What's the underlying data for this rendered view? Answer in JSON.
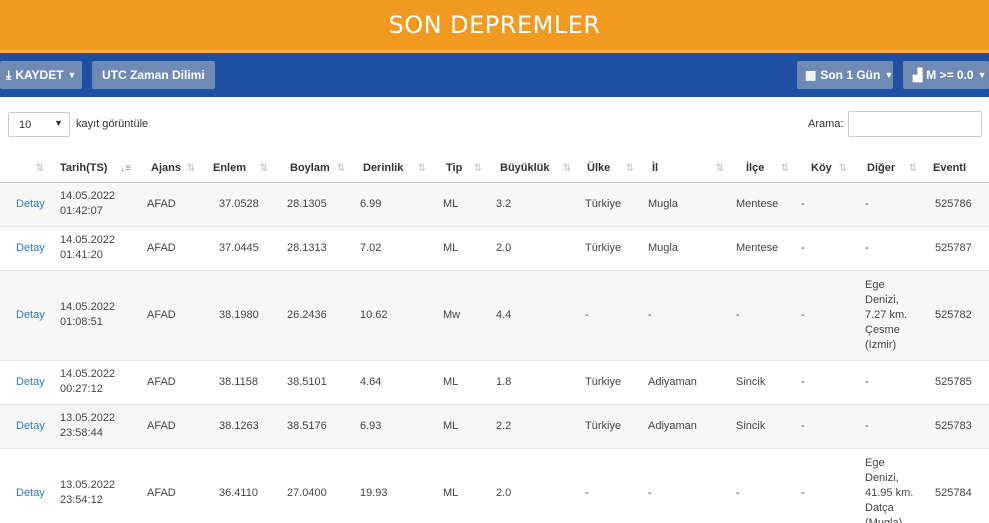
{
  "header": {
    "title": "SON DEPREMLER"
  },
  "toolbar": {
    "save_label": "KAYDET",
    "utc_label": "UTC Zaman Dilimi",
    "period_label": "Son 1 Gün",
    "magnitude_label": "M >= 0.0"
  },
  "controls": {
    "length_value": "10",
    "length_label": "kayıt görüntüle",
    "search_label": "Arama:",
    "search_value": ""
  },
  "table": {
    "columns": [
      "",
      "Tarih(TS)",
      "Ajans",
      "Enlem",
      "Boylam",
      "Derinlik",
      "Tip",
      "Büyüklük",
      "Ülke",
      "İl",
      "İlçe",
      "Köy",
      "Diğer",
      "EventI"
    ],
    "rows": [
      {
        "link": "Detay",
        "date": "14.05.2022",
        "time": "01:42:07",
        "agency": "AFAD",
        "lat": "37.0528",
        "lon": "28.1305",
        "depth": "6.99",
        "type": "ML",
        "mag": "3.2",
        "country": "Türkiye",
        "province": "Mugla",
        "district": "Mentese",
        "village": "-",
        "other": [
          "-"
        ],
        "event": "525786"
      },
      {
        "link": "Detay",
        "date": "14.05.2022",
        "time": "01:41:20",
        "agency": "AFAD",
        "lat": "37.0445",
        "lon": "28.1313",
        "depth": "7.02",
        "type": "ML",
        "mag": "2.0",
        "country": "Türkiye",
        "province": "Mugla",
        "district": "Mentese",
        "village": "-",
        "other": [
          "-"
        ],
        "event": "525787"
      },
      {
        "link": "Detay",
        "date": "14.05.2022",
        "time": "01:08:51",
        "agency": "AFAD",
        "lat": "38.1980",
        "lon": "26.2436",
        "depth": "10.62",
        "type": "Mw",
        "mag": "4.4",
        "country": "-",
        "province": "-",
        "district": "-",
        "village": "-",
        "other": [
          "Ege",
          "Denizi,",
          "7.27 km.",
          "Çesme",
          "(Izmir)"
        ],
        "event": "525782"
      },
      {
        "link": "Detay",
        "date": "14.05.2022",
        "time": "00:27:12",
        "agency": "AFAD",
        "lat": "38.1158",
        "lon": "38.5101",
        "depth": "4.64",
        "type": "ML",
        "mag": "1.8",
        "country": "Türkiye",
        "province": "Adiyaman",
        "district": "Sincik",
        "village": "-",
        "other": [
          "-"
        ],
        "event": "525785"
      },
      {
        "link": "Detay",
        "date": "13.05.2022",
        "time": "23:58:44",
        "agency": "AFAD",
        "lat": "38.1263",
        "lon": "38.5176",
        "depth": "6.93",
        "type": "ML",
        "mag": "2.2",
        "country": "Türkiye",
        "province": "Adiyaman",
        "district": "Sincik",
        "village": "-",
        "other": [
          "-"
        ],
        "event": "525783"
      },
      {
        "link": "Detay",
        "date": "13.05.2022",
        "time": "23:54:12",
        "agency": "AFAD",
        "lat": "36.4110",
        "lon": "27.0400",
        "depth": "19.93",
        "type": "ML",
        "mag": "2.0",
        "country": "-",
        "province": "-",
        "district": "-",
        "village": "-",
        "other": [
          "Ege",
          "Denizi,",
          "41.95 km.",
          "Datça",
          "(Mugla)"
        ],
        "event": "525784"
      }
    ]
  }
}
